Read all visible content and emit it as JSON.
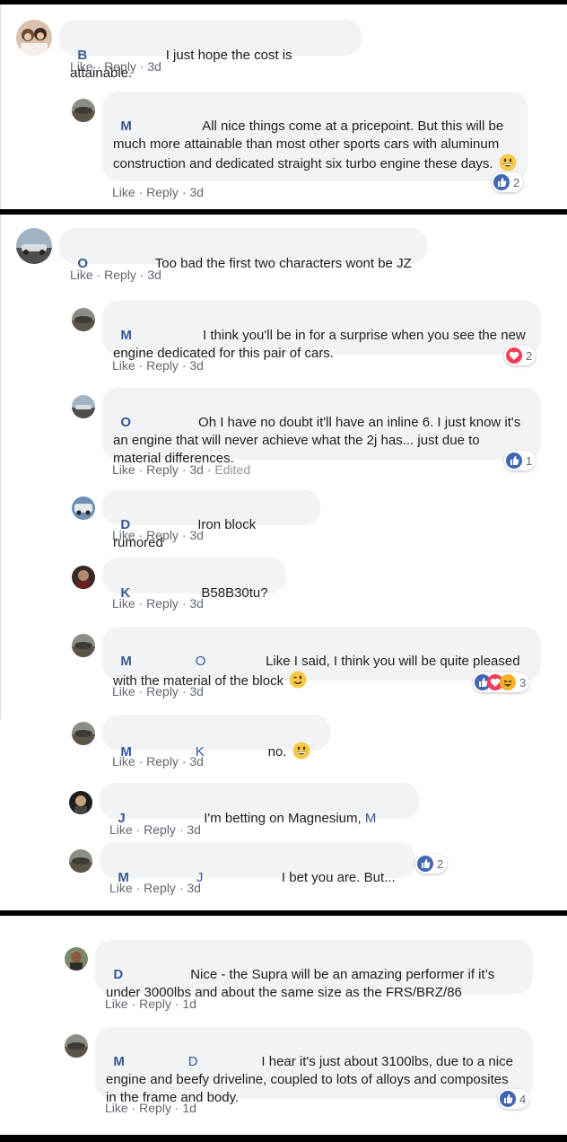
{
  "comments": [
    {
      "name": "B",
      "text": "I just hope the cost is attainable.",
      "meta": {
        "like": "Like",
        "reply": "Reply",
        "time": "3d"
      }
    },
    {
      "name": "M",
      "text": "All nice things come at a pricepoint. But this will be much more attainable than most other sports cars with aluminum construction and dedicated straight six turbo engine these days.",
      "meta": {
        "like": "Like",
        "reply": "Reply",
        "time": "3d"
      },
      "reaction_count": "2"
    },
    {
      "name": "O",
      "text": "Too bad the first two characters wont be JZ",
      "meta": {
        "like": "Like",
        "reply": "Reply",
        "time": "3d"
      }
    },
    {
      "name": "M",
      "text": "I think you'll be in for a surprise when you see the new engine dedicated for this pair of cars.",
      "meta": {
        "like": "Like",
        "reply": "Reply",
        "time": "3d"
      },
      "reaction_count": "2"
    },
    {
      "name": "O",
      "text": "Oh I have no doubt it'll have an inline 6. I just know it's an engine that will never achieve what the 2j has... just due to material differences.",
      "meta": {
        "like": "Like",
        "reply": "Reply",
        "time": "3d",
        "edited": "Edited"
      },
      "reaction_count": "1"
    },
    {
      "name": "D",
      "text": "Iron block rumored",
      "meta": {
        "like": "Like",
        "reply": "Reply",
        "time": "3d"
      }
    },
    {
      "name": "K",
      "text": "B58B30tu?",
      "meta": {
        "like": "Like",
        "reply": "Reply",
        "time": "3d"
      }
    },
    {
      "name": "M",
      "tag": "O",
      "text": "Like I said, I think you will be quite pleased with the material of the block",
      "meta": {
        "like": "Like",
        "reply": "Reply",
        "time": "3d"
      },
      "reaction_count": "3"
    },
    {
      "name": "M",
      "tag": "K",
      "text": "no.",
      "meta": {
        "like": "Like",
        "reply": "Reply",
        "time": "3d"
      }
    },
    {
      "name": "J",
      "text": "I'm betting on Magnesium,",
      "tag_end": "M",
      "meta": {
        "like": "Like",
        "reply": "Reply",
        "time": "3d"
      }
    },
    {
      "name": "M",
      "tag": "J",
      "text": "I bet you are. But...",
      "meta": {
        "like": "Like",
        "reply": "Reply",
        "time": "3d"
      },
      "reaction_count": "2"
    },
    {
      "name": "D",
      "text": "Nice - the Supra will be an amazing performer if it’s under 3000lbs and about the same size as the FRS/BRZ/86",
      "meta": {
        "like": "Like",
        "reply": "Reply",
        "time": "1d"
      }
    },
    {
      "name": "M",
      "tag": "D",
      "text": "I hear it's just about 3100lbs, due to a nice engine and beefy driveline, coupled to lots of alloys and composites in the frame and body.",
      "meta": {
        "like": "Like",
        "reply": "Reply",
        "time": "1d"
      },
      "reaction_count": "4"
    }
  ],
  "icons": {
    "like": "like-reaction-icon",
    "love": "love-reaction-icon",
    "haha": "haha-reaction-icon",
    "grin": "grin-emoji",
    "wink": "wink-emoji"
  },
  "colors": {
    "like": "#4267b2",
    "love": "#f33e58",
    "haha": "#f7b125",
    "name": "#385898",
    "bubble": "#f2f3f5",
    "meta": "#606770"
  }
}
